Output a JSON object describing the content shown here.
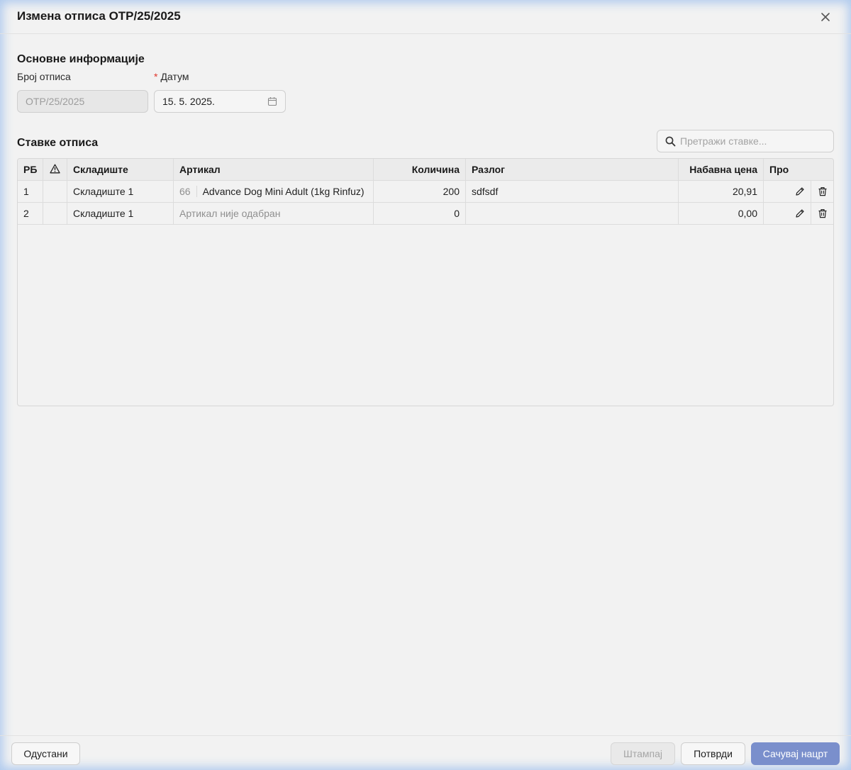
{
  "dialog": {
    "title": "Измена отписа ОТР/25/2025",
    "close_icon": "close-icon"
  },
  "basic_info": {
    "title": "Основне информације",
    "number_label": "Број отписа",
    "number_value": "ОТР/25/2025",
    "date_required_mark": "*",
    "date_label": "Датум",
    "date_value": "15. 5. 2025."
  },
  "items": {
    "title": "Ставке отписа",
    "search_placeholder": "Претражи ставке...",
    "columns": {
      "rb": "РБ",
      "warehouse": "Складиште",
      "article": "Артикал",
      "quantity": "Количина",
      "reason": "Разлог",
      "purchase_price": "Набавна цена",
      "extra": "Про"
    },
    "rows": [
      {
        "rb": "1",
        "warehouse": "Складиште 1",
        "article_code": "66",
        "article": "Advance Dog Mini Adult (1kg Rinfuz)",
        "quantity": "200",
        "reason": "sdfsdf",
        "purchase_price": "20,91"
      },
      {
        "rb": "2",
        "warehouse": "Складиште 1",
        "article_code": "",
        "article": "Артикал није одабран",
        "quantity": "0",
        "reason": "",
        "purchase_price": "0,00"
      }
    ]
  },
  "footer": {
    "cancel": "Одустани",
    "print": "Штампај",
    "confirm": "Потврди",
    "save_draft": "Сачувај нацрт"
  },
  "colors": {
    "primary": "#7a8fcc",
    "required": "#e0352b",
    "background": "#f2f2f2"
  }
}
